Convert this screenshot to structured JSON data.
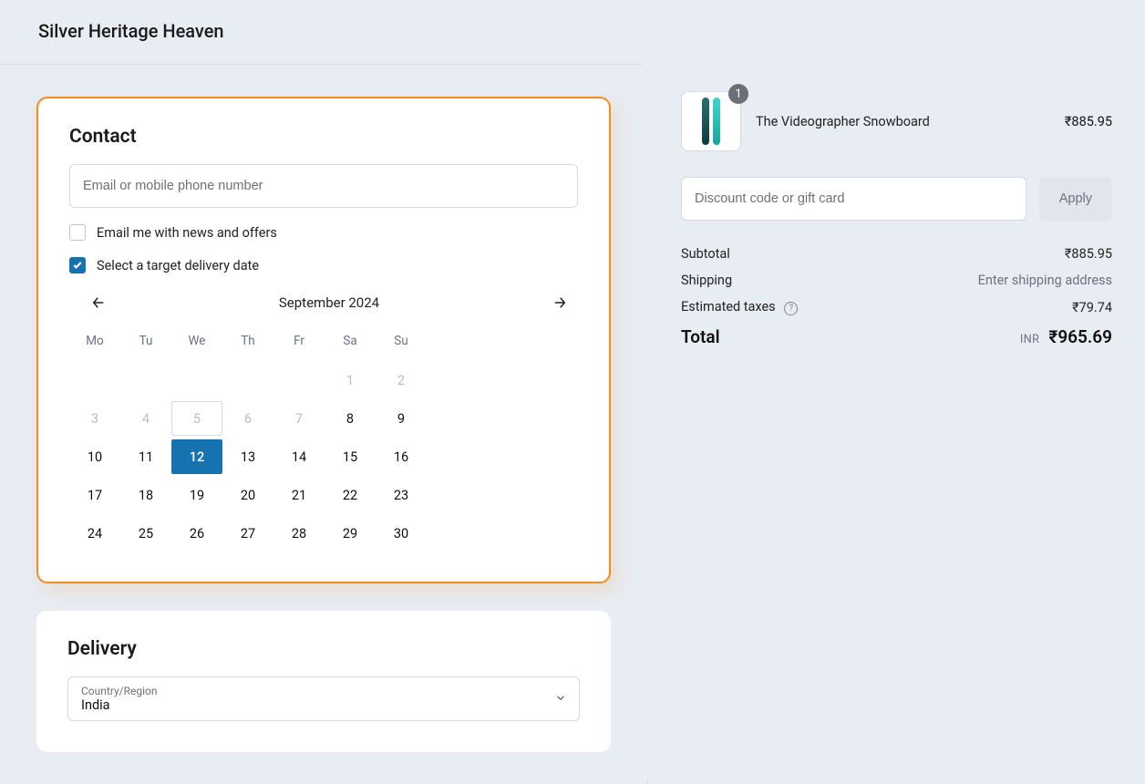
{
  "header": {
    "store_name": "Silver Heritage Heaven"
  },
  "contact": {
    "title": "Contact",
    "email_placeholder": "Email or mobile phone number",
    "news_offers_label": "Email me with news and offers",
    "target_date_label": "Select a target delivery date"
  },
  "calendar": {
    "month_label": "September 2024",
    "weekdays": [
      "Mo",
      "Tu",
      "We",
      "Th",
      "Fr",
      "Sa",
      "Su"
    ],
    "leading_blank": 5,
    "days_in_month": 30,
    "muted_until": 7,
    "today": 5,
    "selected": 12
  },
  "delivery": {
    "title": "Delivery",
    "country_label": "Country/Region",
    "country_value": "India"
  },
  "cart": {
    "item": {
      "name": "The Videographer Snowboard",
      "qty": "1",
      "price": "₹885.95"
    },
    "discount_placeholder": "Discount code or gift card",
    "apply_label": "Apply",
    "subtotal_label": "Subtotal",
    "subtotal_value": "₹885.95",
    "shipping_label": "Shipping",
    "shipping_value": "Enter shipping address",
    "taxes_label": "Estimated taxes",
    "taxes_value": "₹79.74",
    "total_label": "Total",
    "total_currency": "INR",
    "total_value": "₹965.69"
  }
}
